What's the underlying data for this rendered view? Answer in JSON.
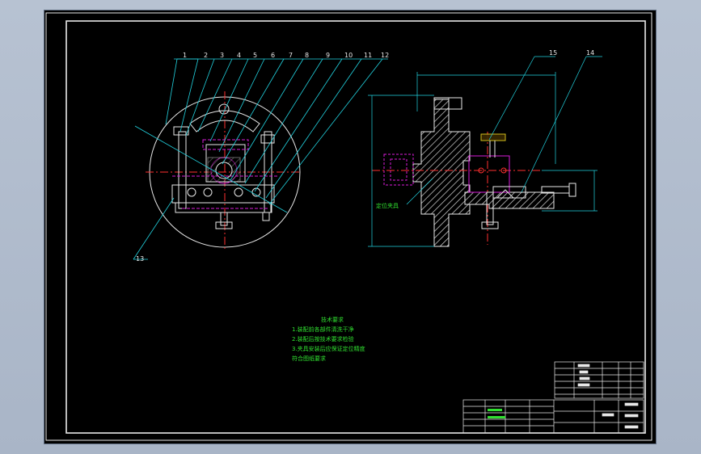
{
  "drawing": {
    "callouts_front": [
      "1",
      "2",
      "3",
      "4",
      "5",
      "6",
      "7",
      "8",
      "9",
      "10",
      "11",
      "12"
    ],
    "callout_13": "13",
    "callouts_side": [
      "15",
      "14"
    ],
    "tech_requirements": {
      "title": "技术要求",
      "lines": [
        "1.装配前各部件清洗干净",
        "2.装配后按技术要求检验",
        "3.夹具安装后应保证定位精度",
        "  符合图纸要求"
      ]
    },
    "side_label": "定位夹具"
  },
  "colors": {
    "background": "#000000",
    "outline": "#e8e8e8",
    "dimension": "#22d3e0",
    "centerline": "#ff3030",
    "hidden": "#d81cd8",
    "text": "#30e030"
  }
}
